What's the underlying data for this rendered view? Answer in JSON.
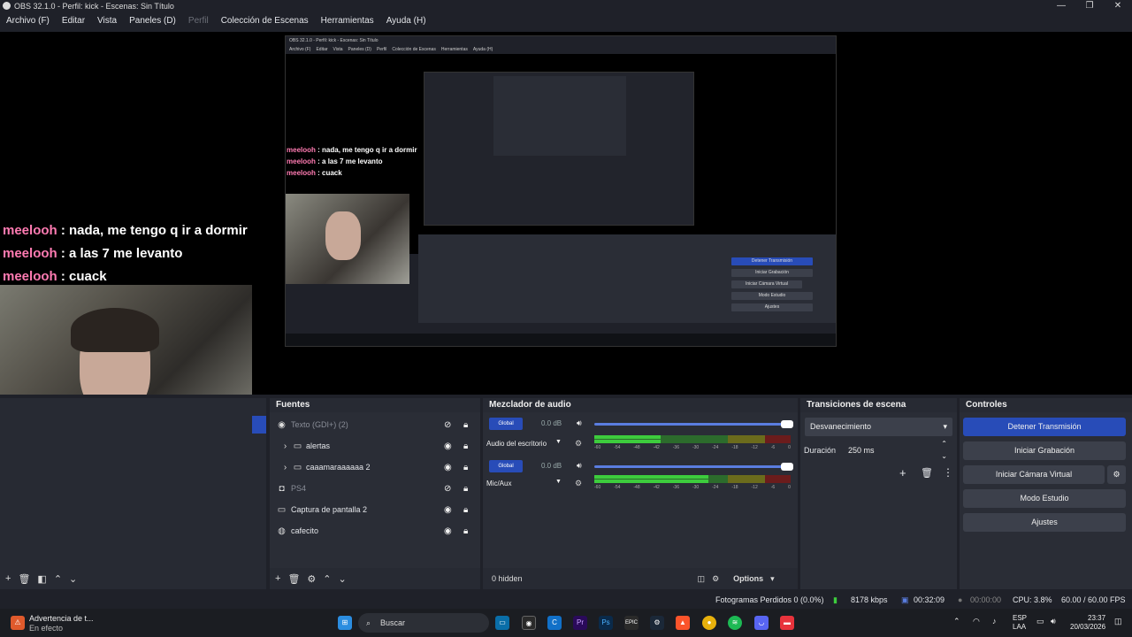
{
  "window": {
    "title": "OBS 32.1.0 - Perfil: kick - Escenas: Sin Título",
    "controls": [
      "—",
      "❐",
      "✕"
    ]
  },
  "menu": [
    "Archivo (F)",
    "Editar",
    "Vista",
    "Paneles (D)",
    "Perfil",
    "Colección de Escenas",
    "Herramientas",
    "Ayuda (H)"
  ],
  "preview": {
    "chat": [
      {
        "user": "meelooh",
        "text": " : nada, me tengo q ir a dormir"
      },
      {
        "user": "meelooh",
        "text": " : a las 7 me levanto"
      },
      {
        "user": "meelooh",
        "text": " : cuack"
      }
    ],
    "nested_title": "OBS 32.1.0 - Perfil: kick - Escenas: Sin Título",
    "nested_menu": [
      "Archivo (F)",
      "Editar",
      "Vista",
      "Paneles (D)",
      "Perfil",
      "Colección de Escenas",
      "Herramientas",
      "Ayuda (H)"
    ],
    "nested_buttons": [
      "Detener Transmisión",
      "Iniciar Grabación",
      "Iniciar Cámara Virtual",
      "Modo Estudio",
      "Ajustes"
    ]
  },
  "docks": {
    "sources_title": "Fuentes",
    "mixer_title": "Mezclador de audio",
    "transitions_title": "Transiciones de escena",
    "controls_title": "Controles"
  },
  "sources": [
    {
      "label": "Texto (GDI+) (2)",
      "hidden": true
    },
    {
      "label": "alertas",
      "hidden": false
    },
    {
      "label": "caaamaraaaaaa 2",
      "hidden": false
    },
    {
      "label": "PS4",
      "hidden": true
    },
    {
      "label": "Captura de pantalla 2",
      "hidden": false
    },
    {
      "label": "cafecito",
      "hidden": false
    }
  ],
  "mixer": {
    "channels": [
      {
        "badge": "Global",
        "db": "0.0 dB",
        "name": "Audio del escritorio",
        "level": 0.34
      },
      {
        "badge": "Global",
        "db": "0.0 dB",
        "name": "Mic/Aux",
        "level": 0.58
      }
    ],
    "ticks": [
      "-60",
      "-54",
      "-48",
      "-42",
      "-36",
      "-30",
      "-24",
      "-18",
      "-12",
      "-6",
      "0"
    ],
    "hidden_label": "0 hidden",
    "options_label": "Options"
  },
  "transitions": {
    "selected": "Desvanecimiento",
    "duration_label": "Duración",
    "duration_value": "250 ms"
  },
  "controls": {
    "stop_stream": "Detener Transmisión",
    "start_record": "Iniciar Grabación",
    "start_vcam": "Iniciar Cámara Virtual",
    "studio_mode": "Modo Estudio",
    "settings": "Ajustes"
  },
  "status": {
    "dropped": "Fotogramas Perdidos 0 (0.0%)",
    "bitrate": "8178 kbps",
    "stream_time": "00:32:09",
    "record_time": "00:00:00",
    "cpu": "CPU: 3.8%",
    "fps": "60.00 / 60.00 FPS"
  },
  "taskbar": {
    "notif_title": "Advertencia de t...",
    "notif_sub": "En efecto",
    "search_placeholder": "Buscar",
    "lang1": "ESP",
    "lang2": "LAA",
    "time": "23:37",
    "date": "20/03/2026",
    "apps": [
      "Pr",
      "Ps",
      "EPIC"
    ]
  },
  "colors": {
    "accent": "#284cb8",
    "username": "#ff7bb2",
    "bg": "#1f2129"
  }
}
